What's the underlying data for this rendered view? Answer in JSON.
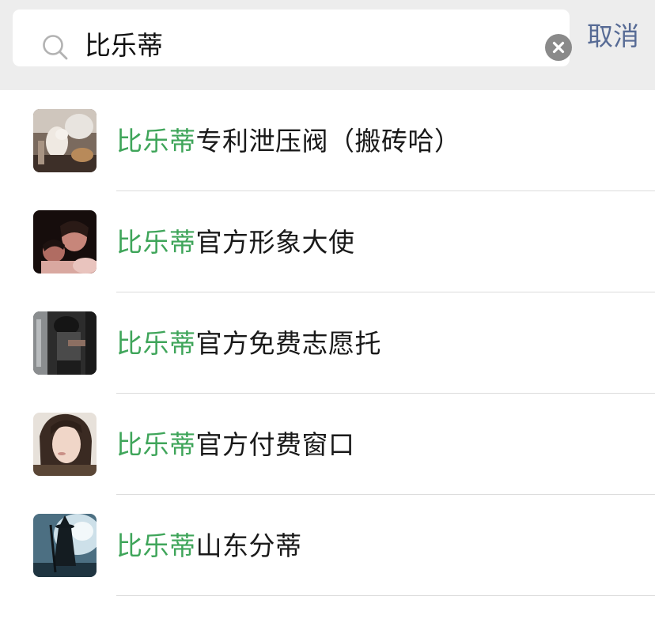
{
  "search": {
    "query": "比乐蒂",
    "cancel_label": "取消"
  },
  "icons": {
    "search": "search-icon",
    "clear": "clear-icon"
  },
  "colors": {
    "header_bg": "#ededed",
    "highlight": "#3fa55a",
    "cancel_link": "#576b95",
    "clear_button": "#8a8a8a"
  },
  "results": [
    {
      "highlight": "比乐蒂",
      "rest": "专利泄压阀（搬砖哈）"
    },
    {
      "highlight": "比乐蒂",
      "rest": "官方形象大使"
    },
    {
      "highlight": "比乐蒂",
      "rest": "官方免费志愿托"
    },
    {
      "highlight": "比乐蒂",
      "rest": "官方付费窗口"
    },
    {
      "highlight": "比乐蒂",
      "rest": "山东分蒂"
    }
  ]
}
